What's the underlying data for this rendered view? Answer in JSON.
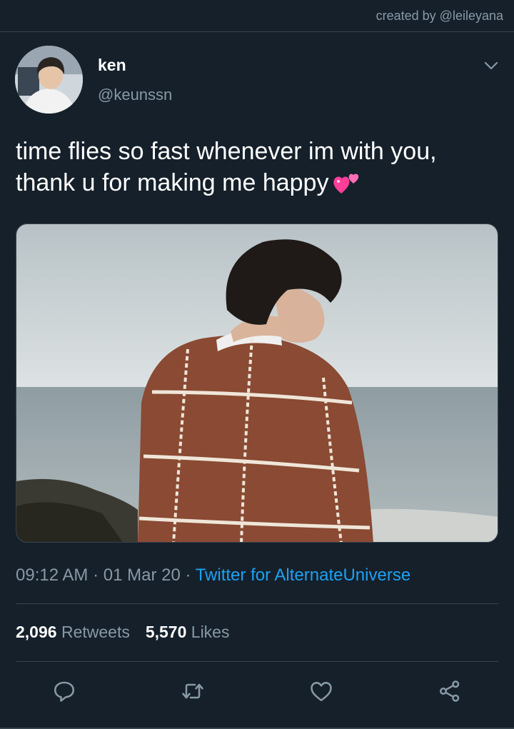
{
  "credit": "created by @leileyana",
  "tweet": {
    "display_name": "ken",
    "handle": "@keunssn",
    "text": "time flies so fast whenever im with you, thank u for making me happy",
    "emoji": "two-hearts",
    "time": "09:12 AM",
    "date": "01 Mar 20",
    "separator": "·",
    "source": "Twitter for AlternateUniverse",
    "retweets_count": "2,096",
    "retweets_label": "Retweets",
    "likes_count": "5,570",
    "likes_label": "Likes"
  },
  "actions": [
    {
      "icon": "reply-icon"
    },
    {
      "icon": "retweet-icon"
    },
    {
      "icon": "like-icon"
    },
    {
      "icon": "share-icon"
    }
  ],
  "colors": {
    "background": "#15202b",
    "primary_text": "#ffffff",
    "secondary_text": "#8899a6",
    "link": "#1da1f2",
    "divider": "#38444d"
  }
}
